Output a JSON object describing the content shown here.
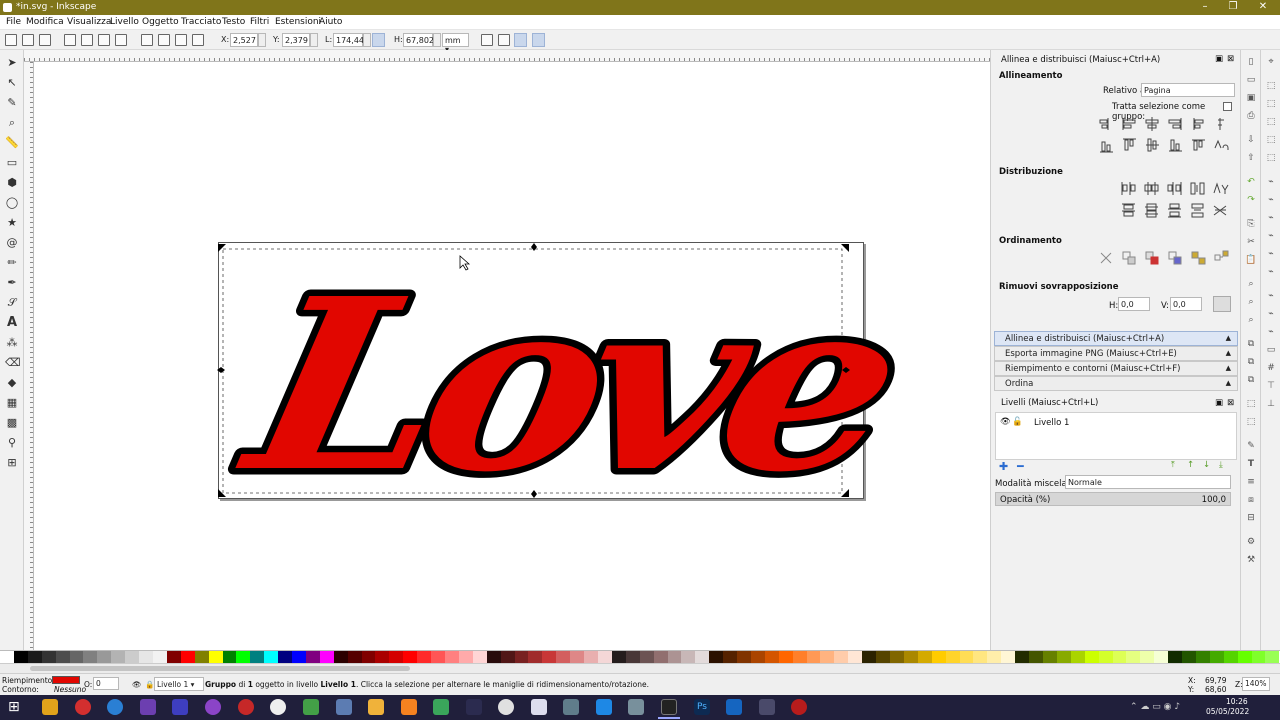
{
  "window": {
    "title": "*in.svg - Inkscape",
    "controls": [
      "–",
      "❐",
      "✕"
    ]
  },
  "menu": [
    "File",
    "Modifica",
    "Visualizza",
    "Livello",
    "Oggetto",
    "Tracciato",
    "Testo",
    "Filtri",
    "Estensioni",
    "Aiuto"
  ],
  "toolbar": {
    "x_label": "X:",
    "x_value": "2,527",
    "y_label": "Y:",
    "y_value": "2,379",
    "w_label": "L:",
    "w_value": "174,443",
    "h_label": "H:",
    "h_value": "67,802",
    "unit": "mm"
  },
  "canvas": {
    "artwork_text": "Love",
    "fill_color": "#e10600",
    "outline_color": "#000000"
  },
  "align_panel": {
    "title": "Allinea e distribuisci (Maiusc+Ctrl+A)",
    "section_align": "Allineamento",
    "relative_label": "Relativo a:",
    "relative_value": "Pagina",
    "treat_group_label": "Tratta selezione come gruppo:",
    "section_distribute": "Distribuzione",
    "section_order": "Ordinamento",
    "section_overlap": "Rimuovi sovrapposizione",
    "h_label": "H:",
    "h_value": "0,0",
    "v_label": "V:",
    "v_value": "0,0"
  },
  "dock_tabs": [
    "Allinea e distribuisci (Maiusc+Ctrl+A)",
    "Esporta immagine PNG (Maiusc+Ctrl+E)",
    "Riempimento e contorni (Maiusc+Ctrl+F)",
    "Ordina"
  ],
  "layers_panel": {
    "title": "Livelli (Maiusc+Ctrl+L)",
    "layer_name": "Livello 1",
    "blend_label": "Modalità miscela:",
    "blend_value": "Normale",
    "opacity_label": "Opacità (%)",
    "opacity_value": "100,0"
  },
  "status": {
    "fill_label": "Riempimento:",
    "stroke_label": "Contorno:",
    "stroke_value": "Nessuno",
    "opacity_label": "O:",
    "opacity_value": "0",
    "layer": "Livello 1",
    "message_bold": "Gruppo",
    "message_1": " di ",
    "message_bold2": "1",
    "message_2": " oggetto in livello ",
    "message_bold3": "Livello 1",
    "message_3": ". Clicca la selezione per alternare le maniglie di ridimensionamento/rotazione.",
    "x_label": "X:",
    "x_value": "69,79",
    "y_label": "Y:",
    "y_value": "68,60",
    "zoom_label": "Z:",
    "zoom_value": "140%",
    "fill_color": "#e10600"
  },
  "taskbar": {
    "time": "10:26",
    "date": "05/05/2022"
  }
}
